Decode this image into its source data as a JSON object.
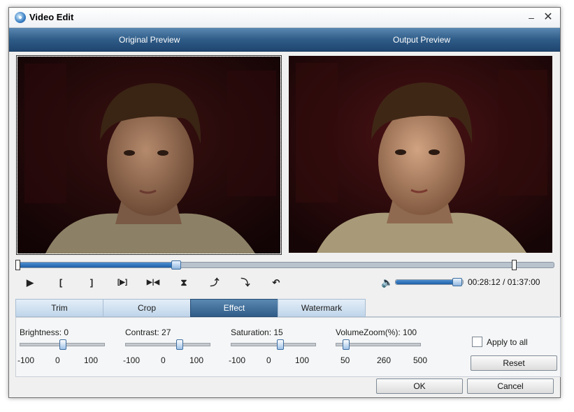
{
  "window": {
    "title": "Video Edit",
    "minimize_label": "–",
    "close_label": "✕"
  },
  "preview": {
    "original_label": "Original Preview",
    "output_label": "Output Preview"
  },
  "playback": {
    "progress": 0.295,
    "time_text": "00:28:12 / 01:37:00",
    "volume": 0.93,
    "controls": [
      {
        "name": "play-icon",
        "glyph": "▶"
      },
      {
        "name": "mark-in-icon",
        "glyph": "["
      },
      {
        "name": "mark-out-icon",
        "glyph": "]"
      },
      {
        "name": "play-selection-icon",
        "glyph": "[▶]"
      },
      {
        "name": "next-frame-icon",
        "glyph": "▶|◀"
      },
      {
        "name": "flip-vertical-icon",
        "glyph": "⧗"
      },
      {
        "name": "rotate-left-icon",
        "glyph": "⤴"
      },
      {
        "name": "rotate-right-icon",
        "glyph": "⤵"
      },
      {
        "name": "undo-icon",
        "glyph": "↶"
      }
    ]
  },
  "tabs": [
    {
      "label": "Trim",
      "active": false
    },
    {
      "label": "Crop",
      "active": false
    },
    {
      "label": "Effect",
      "active": true
    },
    {
      "label": "Watermark",
      "active": false
    }
  ],
  "effect": {
    "sliders": [
      {
        "label": "Brightness: 0",
        "min": "-100",
        "mid": "0",
        "max": "100",
        "level": 0.5
      },
      {
        "label": "Contrast: 27",
        "min": "-100",
        "mid": "0",
        "max": "100",
        "level": 0.635
      },
      {
        "label": "Saturation: 15",
        "min": "-100",
        "mid": "0",
        "max": "100",
        "level": 0.575
      },
      {
        "label": "VolumeZoom(%): 100",
        "min": "50",
        "mid": "260",
        "max": "500",
        "level": 0.11
      }
    ],
    "apply_to_all_label": "Apply to all",
    "apply_to_all_checked": false,
    "reset_label": "Reset"
  },
  "footer": {
    "ok_label": "OK",
    "cancel_label": "Cancel"
  },
  "colors": {
    "header_blue": "#2f5c88",
    "accent_blue": "#1f5fa6"
  }
}
